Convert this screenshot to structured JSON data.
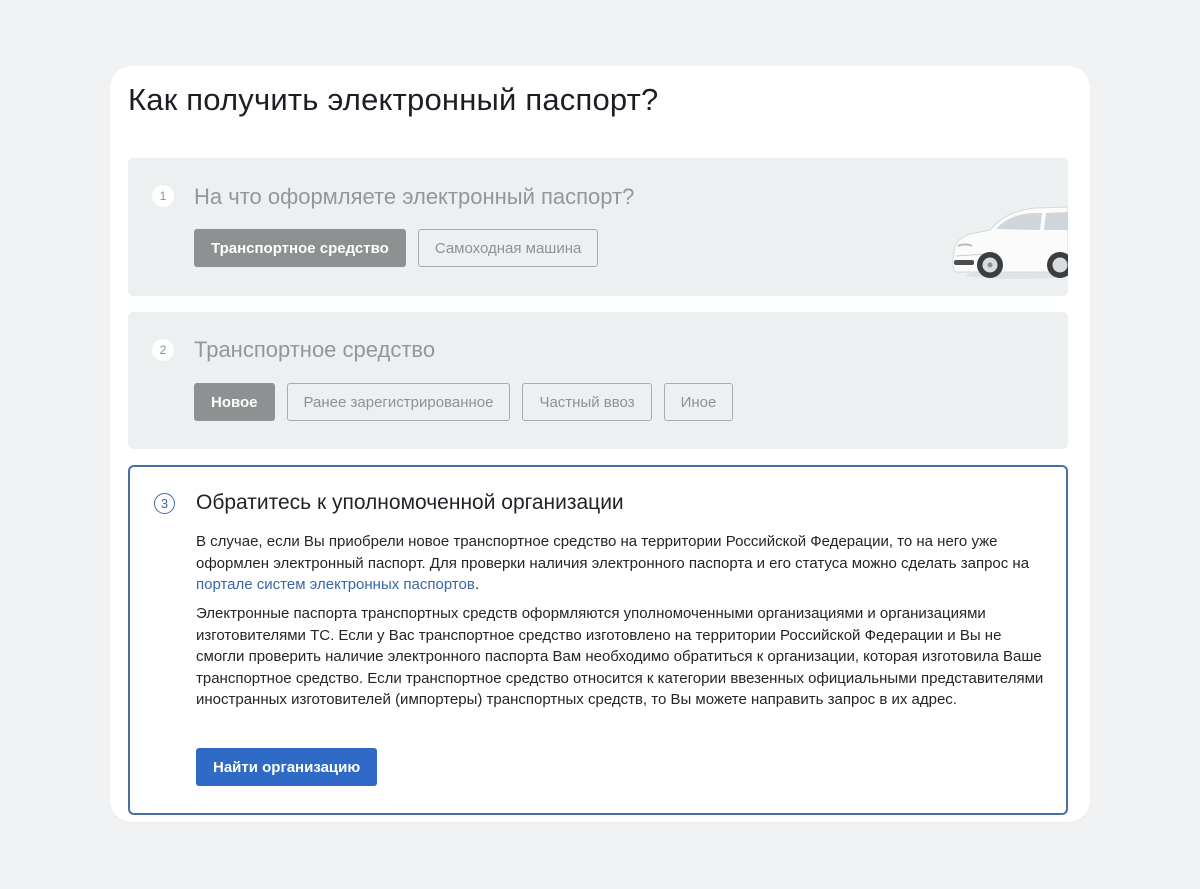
{
  "page": {
    "title": "Как получить электронный паспорт?"
  },
  "step1": {
    "number": "1",
    "title": "На что оформляете электронный паспорт?",
    "options": [
      {
        "label": "Транспортное средство",
        "selected": true
      },
      {
        "label": "Самоходная машина",
        "selected": false
      }
    ],
    "illustration": "car-icon"
  },
  "step2": {
    "number": "2",
    "title": "Транспортное средство",
    "options": [
      {
        "label": "Новое",
        "selected": true
      },
      {
        "label": "Ранее зарегистрированное",
        "selected": false
      },
      {
        "label": "Частный ввоз",
        "selected": false
      },
      {
        "label": "Иное",
        "selected": false
      }
    ]
  },
  "step3": {
    "number": "3",
    "title": "Обратитесь к уполномоченной организации",
    "paragraph1_before_link": "В случае, если Вы приобрели новое транспортное средство на территории Российской Федерации, то на него уже оформлен электронный паспорт. Для проверки наличия электронного паспорта и его статуса можно сделать запрос на ",
    "paragraph1_link": "портале систем электронных паспортов",
    "paragraph1_after_link": ".",
    "paragraph2": "Электронные паспорта транспортных средств оформляются уполномоченными организациями и организациями изготовителями ТС. Если у Вас транспортное средство изготовлено на территории Российской Федерации и Вы не смогли проверить наличие электронного паспорта Вам необходимо обратиться к организации, которая изготовила Ваше транспортное средство. Если транспортное средство относится к категории ввезенных официальными представителями иностранных изготовителей (импортеры) транспортных средств, то Вы можете направить запрос в их адрес.",
    "button_label": "Найти организацию"
  },
  "colors": {
    "accent": "#2f6ac6",
    "active_border": "#4a6fa6",
    "link": "#3a66a8",
    "selected_option": "#8e9192",
    "inactive_step_bg": "#edf0f1",
    "page_bg": "#f1f2f3"
  }
}
